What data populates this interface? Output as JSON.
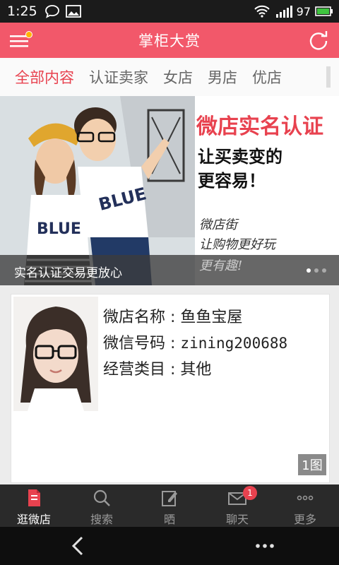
{
  "status_bar": {
    "time": "1:25",
    "battery": "97",
    "icons": [
      "chat-icon",
      "image-icon",
      "wifi-icon",
      "signal-icon",
      "battery-icon"
    ]
  },
  "header": {
    "title": "掌柜大赏",
    "menu_icon": "menu-icon",
    "refresh_icon": "refresh-icon",
    "accent": "#f2586a"
  },
  "tabs": [
    "全部内容",
    "认证卖家",
    "女店",
    "男店",
    "优店"
  ],
  "banner": {
    "headline": "微店实名认证",
    "line2": "让买卖变的",
    "line3": "更容易！",
    "handwriting": [
      "微店街",
      "让购物更好玩",
      "更有趣!"
    ],
    "caption": "实名认证交易更放心",
    "slide_total": 3,
    "slide_active": 1
  },
  "shop": {
    "name_label": "微店名称",
    "name": "鱼鱼宝屋",
    "wechat_label": "微信号码",
    "wechat": "zining200688",
    "category_label": "经营类目",
    "category": "其他",
    "image_count": "1图"
  },
  "tabbar": {
    "items": [
      {
        "label": "逛微店",
        "icon": "phone-store-icon"
      },
      {
        "label": "搜索",
        "icon": "search-icon"
      },
      {
        "label": "晒",
        "icon": "edit-icon"
      },
      {
        "label": "聊天",
        "icon": "mail-icon",
        "badge": "1"
      },
      {
        "label": "更多",
        "icon": "more-icon"
      }
    ]
  },
  "nav": {
    "back_icon": "back-icon",
    "more_icon": "ellipsis-icon"
  }
}
